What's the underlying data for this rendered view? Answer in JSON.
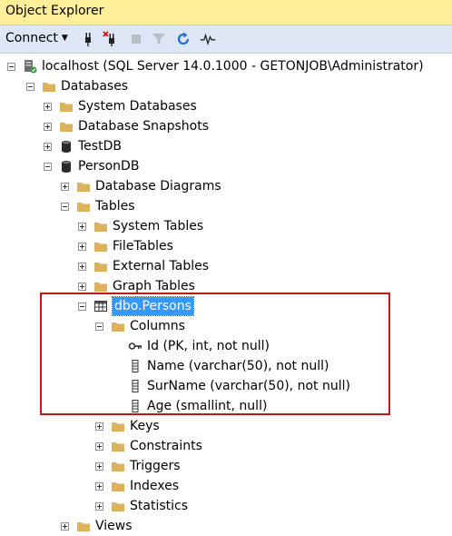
{
  "panel": {
    "title": "Object Explorer"
  },
  "toolbar": {
    "connect_label": "Connect",
    "icons": [
      "connect-plug-icon",
      "disconnect-icon",
      "stop-icon",
      "filter-icon",
      "refresh-icon",
      "activity-monitor-icon"
    ]
  },
  "tree": {
    "server": "localhost (SQL Server 14.0.1000 - GETONJOB\\Administrator)",
    "databases": "Databases",
    "system_databases": "System Databases",
    "database_snapshots": "Database Snapshots",
    "testdb": "TestDB",
    "persondb": "PersonDB",
    "database_diagrams": "Database Diagrams",
    "tables": "Tables",
    "system_tables": "System Tables",
    "filetables": "FileTables",
    "external_tables": "External Tables",
    "graph_tables": "Graph Tables",
    "persons_table": "dbo.Persons",
    "columns": "Columns",
    "col_id": "Id (PK, int, not null)",
    "col_name": "Name (varchar(50), not null)",
    "col_surname": "SurName (varchar(50), not null)",
    "col_age": "Age (smallint, null)",
    "keys": "Keys",
    "constraints": "Constraints",
    "triggers": "Triggers",
    "indexes": "Indexes",
    "statistics": "Statistics",
    "views": "Views"
  },
  "colors": {
    "title_bg": "#ffef99",
    "toolbar_bg": "#dce6f4",
    "selection": "#3399ff",
    "highlight_border": "#c0181a",
    "folder": "#dcb35c"
  }
}
